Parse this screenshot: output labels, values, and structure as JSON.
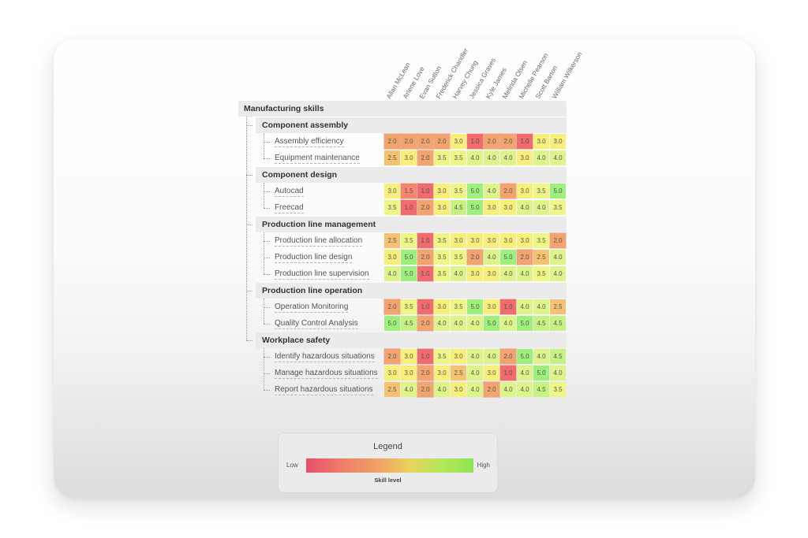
{
  "title": "Manufacturing skills",
  "employees": [
    "Allan McLean",
    "Arlene Love",
    "Evan Sutton",
    "Frederick Chandler",
    "Harvey Chung",
    "Jessica Graves",
    "Kyle James",
    "Melinda Olsen",
    "Michelle Pearson",
    "Scott Barton",
    "William Wilkerson"
  ],
  "color_scale": {
    "1.0": "#f06a6e",
    "1.5": "#f3866c",
    "2.0": "#f3a46e",
    "2.5": "#f5c272",
    "3.0": "#f8ef7a",
    "3.5": "#eef685",
    "4.0": "#ddf48a",
    "4.5": "#c6f283",
    "5.0": "#9ef07c"
  },
  "groups": [
    {
      "label": "Component assembly",
      "skills": [
        {
          "label": "Assembly efficiency",
          "values": [
            "2.0",
            "2.0",
            "2.0",
            "2.0",
            "3.0",
            "1.0",
            "2.0",
            "2.0",
            "1.0",
            "3.0",
            "3.0"
          ]
        },
        {
          "label": "Equipment maintenance",
          "values": [
            "2.5",
            "3.0",
            "2.0",
            "3.5",
            "3.5",
            "4.0",
            "4.0",
            "4.0",
            "3.0",
            "4.0",
            "4.0"
          ]
        }
      ]
    },
    {
      "label": "Component design",
      "skills": [
        {
          "label": "Autocad",
          "values": [
            "3.0",
            "1.5",
            "1.0",
            "3.0",
            "3.5",
            "5.0",
            "4.0",
            "2.0",
            "3.0",
            "3.5",
            "5.0"
          ]
        },
        {
          "label": "Freecad",
          "values": [
            "3.5",
            "1.0",
            "2.0",
            "3.0",
            "4.5",
            "5.0",
            "3.0",
            "3.0",
            "4.0",
            "4.0",
            "3.5"
          ]
        }
      ]
    },
    {
      "label": "Production line management",
      "skills": [
        {
          "label": "Production line allocation",
          "values": [
            "2.5",
            "3.5",
            "1.0",
            "3.5",
            "3.0",
            "3.0",
            "3.0",
            "3.0",
            "3.0",
            "3.5",
            "2.0"
          ]
        },
        {
          "label": "Production line design",
          "values": [
            "3.0",
            "5.0",
            "2.0",
            "3.5",
            "3.5",
            "2.0",
            "4.0",
            "5.0",
            "2.0",
            "2.5",
            "4.0"
          ]
        },
        {
          "label": "Production line supervision",
          "values": [
            "4.0",
            "5.0",
            "1.0",
            "3.5",
            "4.0",
            "3.0",
            "3.0",
            "4.0",
            "4.0",
            "3.5",
            "4.0"
          ]
        }
      ]
    },
    {
      "label": "Production line operation",
      "skills": [
        {
          "label": "Operation Monitoring",
          "values": [
            "2.0",
            "3.5",
            "1.0",
            "3.0",
            "3.5",
            "5.0",
            "3.0",
            "1.0",
            "4.0",
            "4.0",
            "2.5"
          ]
        },
        {
          "label": "Quality Control Analysis",
          "values": [
            "5.0",
            "4.5",
            "2.0",
            "4.0",
            "4.0",
            "4.0",
            "5.0",
            "4.0",
            "5.0",
            "4.5",
            "4.5"
          ]
        }
      ]
    },
    {
      "label": "Workplace safety",
      "skills": [
        {
          "label": "Identify hazardous situations",
          "values": [
            "2.0",
            "3.0",
            "1.0",
            "3.5",
            "3.0",
            "4.0",
            "4.0",
            "2.0",
            "5.0",
            "4.0",
            "4.5"
          ]
        },
        {
          "label": "Manage hazardous situations",
          "values": [
            "3.0",
            "3.0",
            "2.0",
            "3.0",
            "2.5",
            "4.0",
            "3.0",
            "1.0",
            "4.0",
            "5.0",
            "4.0"
          ]
        },
        {
          "label": "Report hazardous situations",
          "values": [
            "2.5",
            "4.0",
            "2.0",
            "4.0",
            "3.0",
            "4.0",
            "2.0",
            "4.0",
            "4.0",
            "4.5",
            "3.5"
          ]
        }
      ]
    }
  ],
  "legend": {
    "title": "Legend",
    "low": "Low",
    "high": "High",
    "subtitle": "Skill level"
  }
}
